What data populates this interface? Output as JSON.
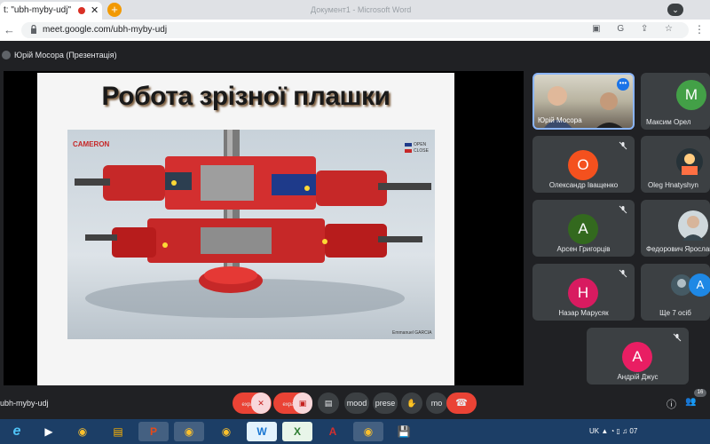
{
  "browser": {
    "tab_title": "t: \"ubh-myby-udj\"",
    "tab_close": "✕",
    "new_tab": "+",
    "ghost_title": "Документ1 - Microsoft Word",
    "url": "meet.google.com/ubh-myby-udj",
    "omni_icons": "▣ G ⇪ ☆",
    "menu": "⋮",
    "back": "←"
  },
  "meet": {
    "presenter_label": "Юрій Мосора (Презентація)",
    "meeting_code": "ubh-myby-udj",
    "slide": {
      "title": "Робота зрізної плашки",
      "logo": "CAMERON",
      "legend_open": "OPEN",
      "legend_close": "CLOSE",
      "credit": "Emmanuel GARCIA"
    },
    "participants": [
      {
        "name": "Юрій Мосора",
        "initial": "",
        "color": ""
      },
      {
        "name": "Максим Орел",
        "initial": "M",
        "color": "#43a047"
      },
      {
        "name": "Олександр Іващенко",
        "initial": "О",
        "color": "#f4511e"
      },
      {
        "name": "Oleg Hnatyshyn",
        "initial": "",
        "color": ""
      },
      {
        "name": "Арсен Григорців",
        "initial": "А",
        "color": "#33691e"
      },
      {
        "name": "Федорович Ярослав",
        "initial": "",
        "color": ""
      },
      {
        "name": "Назар Марусяк",
        "initial": "Н",
        "color": "#d81b60"
      },
      {
        "name": "Ще 7 осіб",
        "initial": "A",
        "color": "#1e88e5"
      },
      {
        "name": "Андрій Джус",
        "initial": "А",
        "color": "#e91e63"
      }
    ],
    "controls": {
      "mic": "expand_",
      "cam": "expand_",
      "captions": "▤",
      "mood": "mood",
      "present": "prese",
      "hand": "✋",
      "more": "mo",
      "end_call": "☎",
      "info": "ⓘ",
      "people": "👥",
      "people_count": "16",
      "chat": "💬"
    }
  },
  "taskbar": {
    "apps": [
      "e",
      "▶",
      "◉",
      "▤",
      "P",
      "◉",
      "◉",
      "W",
      "X",
      "A",
      "◉",
      "💾"
    ],
    "tray_text": "UK ▲ ◔ ▯ ♫ 07"
  }
}
